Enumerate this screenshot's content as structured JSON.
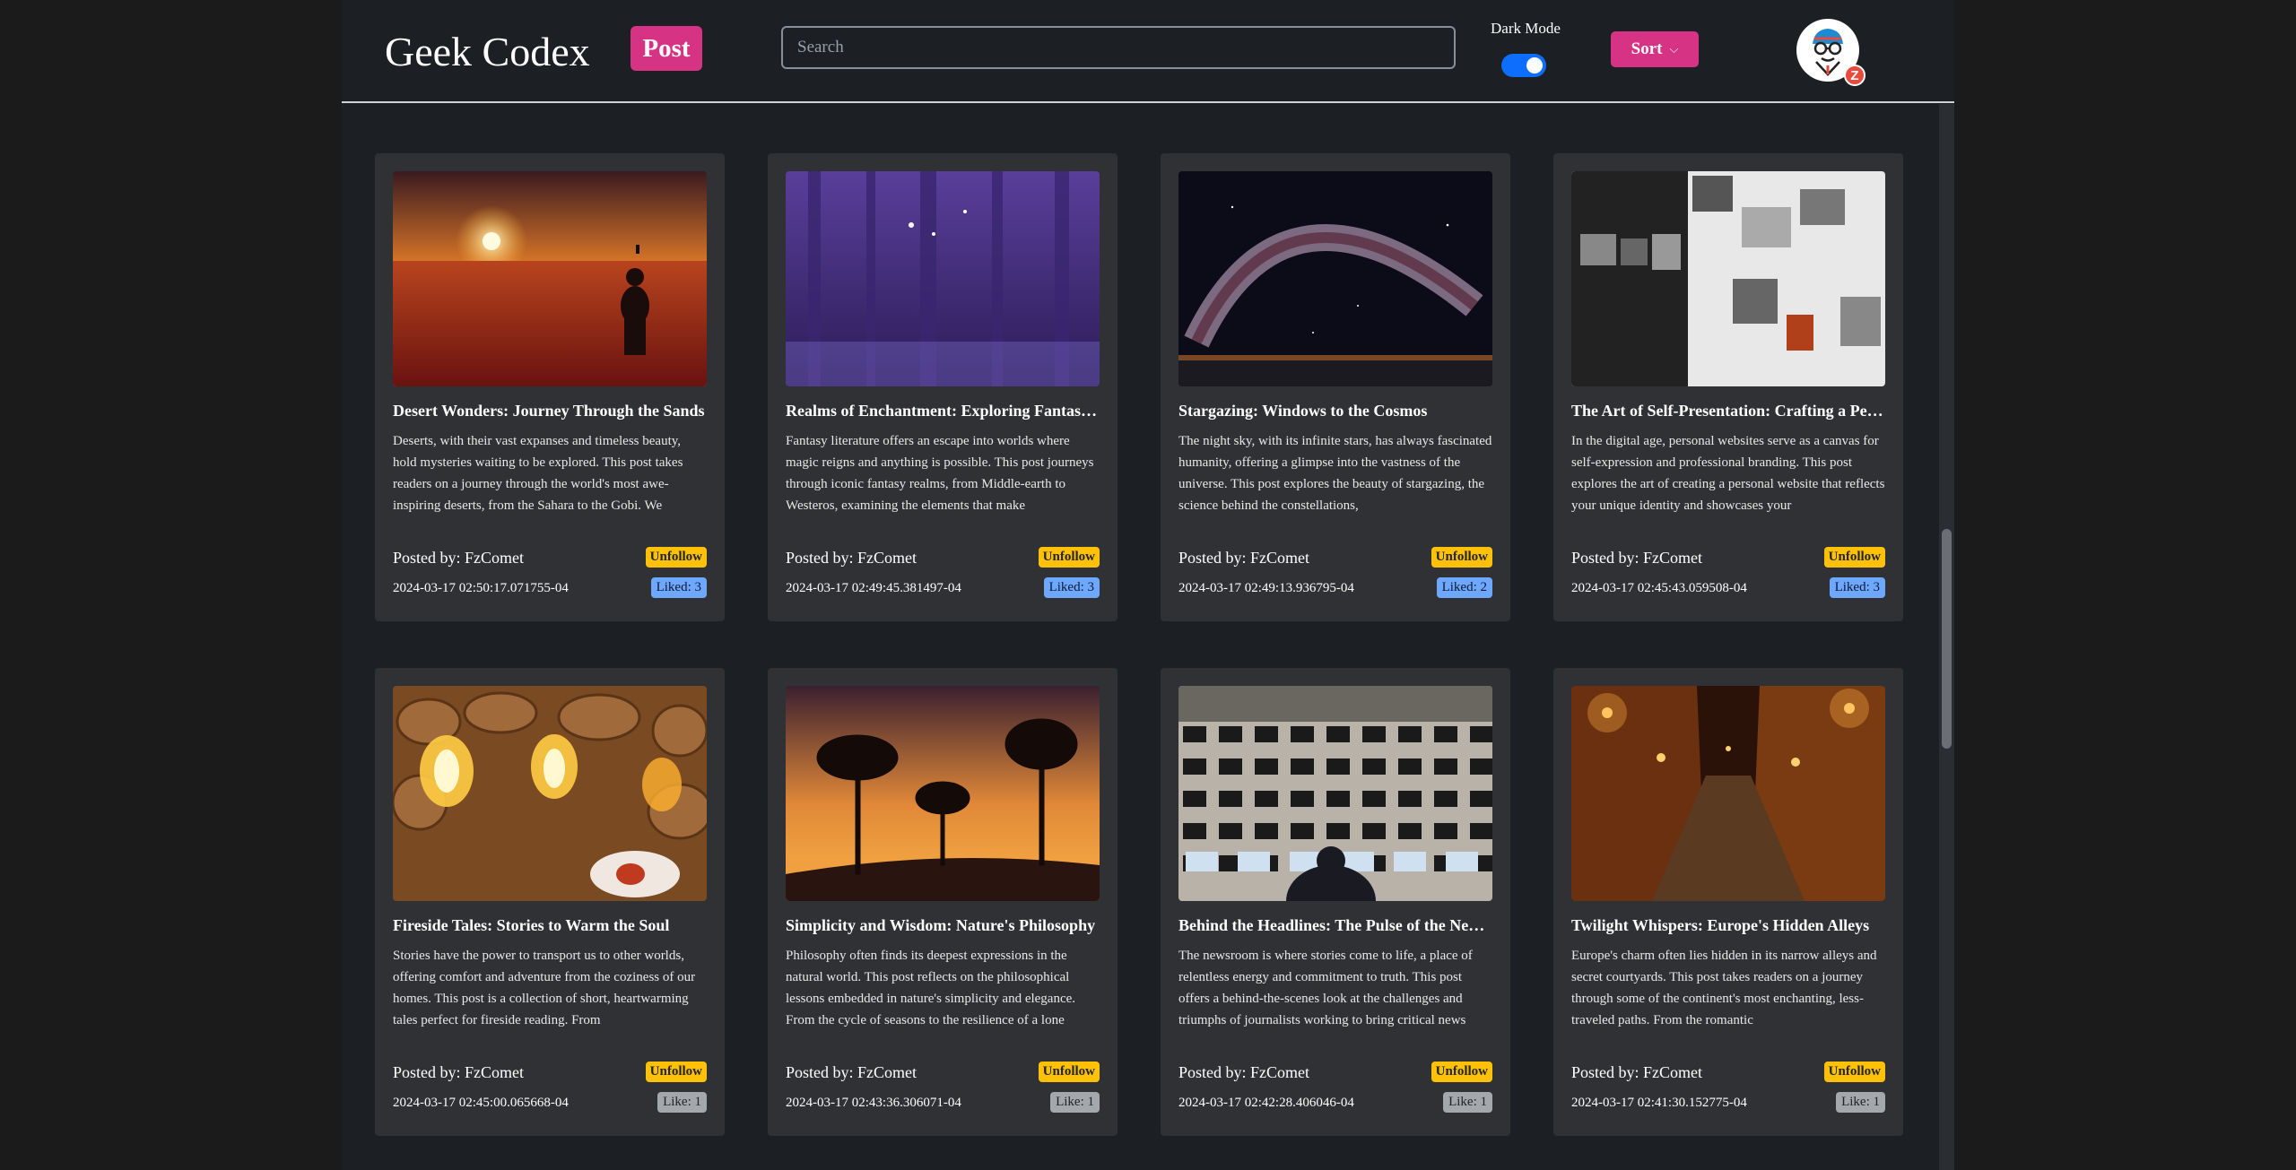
{
  "header": {
    "brand": "Geek Codex",
    "post_label": "Post",
    "search_placeholder": "Search",
    "dark_mode_label": "Dark Mode",
    "dark_mode_on": true,
    "sort_label": "Sort",
    "avatar_badge": "Z"
  },
  "colors": {
    "accent_pink": "#d63384",
    "toggle_blue": "#0d6efd",
    "follow_yellow": "#ffc107",
    "liked_blue": "#6ea8fe",
    "like_gray": "#a4a7ab"
  },
  "posts": [
    {
      "title": "Desert Wonders: Journey Through the Sands",
      "excerpt": "Deserts, with their vast expanses and timeless beauty, hold mysteries waiting to be explored. This post takes readers on a journey through the world's most awe-inspiring deserts, from the Sahara to the Gobi. We",
      "author": "Posted by: FzComet",
      "date": "2024-03-17 02:50:17.071755-04",
      "follow_label": "Unfollow",
      "like_label": "Liked: 3",
      "liked": true,
      "image": "desert"
    },
    {
      "title": "Realms of Enchantment: Exploring Fantasy Literature",
      "excerpt": "Fantasy literature offers an escape into worlds where magic reigns and anything is possible. This post journeys through iconic fantasy realms, from Middle-earth to Westeros, examining the elements that make",
      "author": "Posted by: FzComet",
      "date": "2024-03-17 02:49:45.381497-04",
      "follow_label": "Unfollow",
      "like_label": "Liked: 3",
      "liked": true,
      "image": "forest"
    },
    {
      "title": "Stargazing: Windows to the Cosmos",
      "excerpt": "The night sky, with its infinite stars, has always fascinated humanity, offering a glimpse into the vastness of the universe. This post explores the beauty of stargazing, the science behind the constellations,",
      "author": "Posted by: FzComet",
      "date": "2024-03-17 02:49:13.936795-04",
      "follow_label": "Unfollow",
      "like_label": "Liked: 2",
      "liked": true,
      "image": "galaxy"
    },
    {
      "title": "The Art of Self-Presentation: Crafting a Personal Website",
      "excerpt": "In the digital age, personal websites serve as a canvas for self-expression and professional branding. This post explores the art of creating a personal website that reflects your unique identity and showcases your",
      "author": "Posted by: FzComet",
      "date": "2024-03-17 02:45:43.059508-04",
      "follow_label": "Unfollow",
      "like_label": "Liked: 3",
      "liked": true,
      "image": "website"
    },
    {
      "title": "Fireside Tales: Stories to Warm the Soul",
      "excerpt": "Stories have the power to transport us to other worlds, offering comfort and adventure from the coziness of our homes. This post is a collection of short, heartwarming tales perfect for fireside reading. From",
      "author": "Posted by: FzComet",
      "date": "2024-03-17 02:45:00.065668-04",
      "follow_label": "Unfollow",
      "like_label": "Like: 1",
      "liked": false,
      "image": "fireplace"
    },
    {
      "title": "Simplicity and Wisdom: Nature's Philosophy",
      "excerpt": "Philosophy often finds its deepest expressions in the natural world. This post reflects on the philosophical lessons embedded in nature's simplicity and elegance. From the cycle of seasons to the resilience of a lone",
      "author": "Posted by: FzComet",
      "date": "2024-03-17 02:43:36.306071-04",
      "follow_label": "Unfollow",
      "like_label": "Like: 1",
      "liked": false,
      "image": "trees"
    },
    {
      "title": "Behind the Headlines: The Pulse of the Newsroom",
      "excerpt": "The newsroom is where stories come to life, a place of relentless energy and commitment to truth. This post offers a behind-the-scenes look at the challenges and triumphs of journalists working to bring critical news",
      "author": "Posted by: FzComet",
      "date": "2024-03-17 02:42:28.406046-04",
      "follow_label": "Unfollow",
      "like_label": "Like: 1",
      "liked": false,
      "image": "newsroom"
    },
    {
      "title": "Twilight Whispers: Europe's Hidden Alleys",
      "excerpt": "Europe's charm often lies hidden in its narrow alleys and secret courtyards. This post takes readers on a journey through some of the continent's most enchanting, less-traveled paths. From the romantic",
      "author": "Posted by: FzComet",
      "date": "2024-03-17 02:41:30.152775-04",
      "follow_label": "Unfollow",
      "like_label": "Like: 1",
      "liked": false,
      "image": "alley"
    }
  ]
}
